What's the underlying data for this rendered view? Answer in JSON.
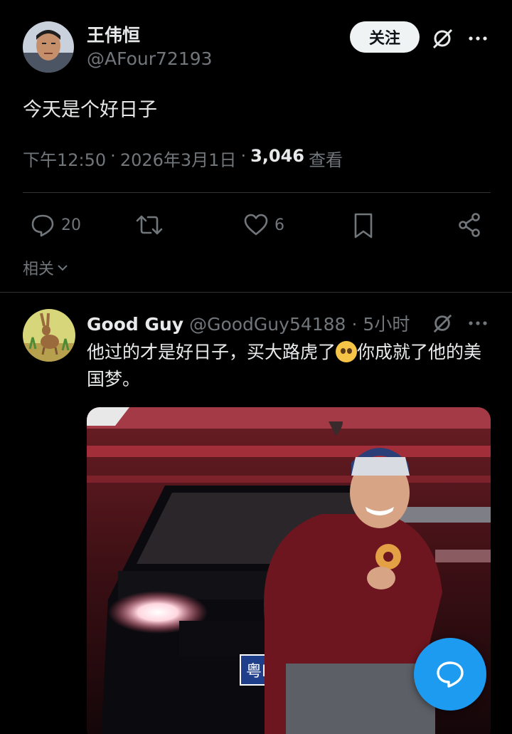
{
  "tweet": {
    "author_name": "王伟恒",
    "author_handle": "@AFour72193",
    "follow_label": "关注",
    "text": "今天是个好日子",
    "time": "下午12:50",
    "date": "2026年3月1日",
    "views_count": "3,046",
    "views_label": "查看",
    "reply_count": "20",
    "like_count": "6",
    "related_label": "相关"
  },
  "reply": {
    "author_name": "Good Guy",
    "author_handle": "@GoodGuy54188",
    "time": "5小时",
    "text_part1": "他过的才是好日子，买大路虎了",
    "text_part2": "你成就了他的美国梦。"
  },
  "media": {
    "plate_text": "粤B"
  },
  "colors": {
    "accent": "#1d9bf0",
    "muted": "#71767b",
    "background": "#000000"
  },
  "icons": [
    "grok-icon",
    "more-icon",
    "reply-icon",
    "retweet-icon",
    "like-icon",
    "bookmark-icon",
    "share-icon",
    "chevron-down-icon",
    "compose-reply-icon"
  ]
}
